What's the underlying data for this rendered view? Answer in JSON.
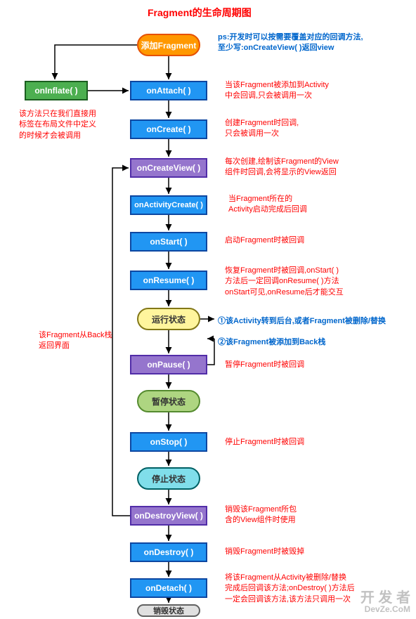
{
  "title": "Fragment的生命周期图",
  "nodes": {
    "addFragment": "添加Fragment",
    "onInflate": "onInflate( )",
    "onAttach": "onAttach( )",
    "onCreate": "onCreate( )",
    "onCreateView": "onCreateView( )",
    "onActivityCreate": "onActivityCreate( )",
    "onStart": "onStart( )",
    "onResume": "onResume( )",
    "running": "运行状态",
    "onPause": "onPause( )",
    "paused": "暂停状态",
    "onStop": "onStop( )",
    "stopped": "停止状态",
    "onDestroyView": "onDestroyView( )",
    "onDestroy": "onDestroy( )",
    "onDetach": "onDetach( )",
    "destroyed": "销毁状态"
  },
  "notes": {
    "ps": "ps:开发时可以按需要覆盖对应的回调方法,\n至少写:onCreateView( )返回view",
    "onInflateNote": "该方法只在我们直接用\n标签在布局文件中定义\n的时候才会被调用",
    "onAttachNote": "当该Fragment被添加到Activity\n中会回调,只会被调用一次",
    "onCreateNote": "创建Fragment时回调,\n只会被调用一次",
    "onCreateViewNote": "每次创建,绘制该Fragment的View\n组件时回调,会将显示的View返回",
    "onActivityCreateNote": "当Fragment所在的\nActivity启动完成后回调",
    "onStartNote": "启动Fragment时被回调",
    "onResumeNote": "恢复Fragment时被回调,onStart( )\n方法后一定回调onResume( )方法\nonStart可见,onResume后才能交互",
    "runningNote1": "①该Activity转到后台,或者Fragment被删除/替换",
    "runningNote2": "②该Fragment被添加到Back栈",
    "backNote": "该Fragment从Back栈\n返回界面",
    "onPauseNote": "暂停Fragment时被回调",
    "onStopNote": "停止Fragment时被回调",
    "onDestroyViewNote": "销毁该Fragment所包\n含的View组件时使用",
    "onDestroyNote": "销毁Fragment时被毁掉",
    "onDetachNote": "将该Fragment从Activity被删除/替换\n完成后回调该方法;onDestroy( )方法后\n一定会回调该方法,该方法只调用一次"
  },
  "watermark": {
    "big": "开 发 者",
    "small": "DevZe.CoM"
  }
}
